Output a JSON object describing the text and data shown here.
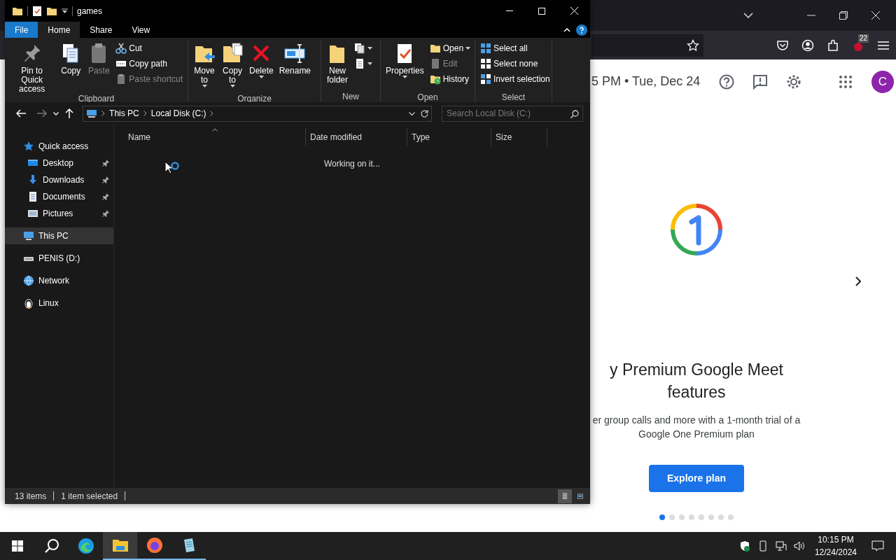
{
  "explorer": {
    "title": "games",
    "tabs": [
      {
        "label": "File",
        "kind": "file",
        "selected": false
      },
      {
        "label": "Home",
        "kind": "tab",
        "selected": true
      },
      {
        "label": "Share",
        "kind": "tab",
        "selected": false
      },
      {
        "label": "View",
        "kind": "tab",
        "selected": false
      }
    ],
    "ribbon": [
      {
        "label": "Clipboard",
        "items": [
          {
            "label": "Pin to Quick\naccess",
            "kind": "large",
            "disabled": false,
            "dropdown": false
          },
          {
            "label": "Copy",
            "kind": "large",
            "disabled": false,
            "dropdown": false
          },
          {
            "label": "Paste",
            "kind": "large",
            "disabled": true,
            "dropdown": false
          },
          {
            "label": "Cut",
            "kind": "small",
            "disabled": false,
            "dropdown": false
          },
          {
            "label": "Copy path",
            "kind": "small",
            "disabled": false,
            "dropdown": false
          },
          {
            "label": "Paste shortcut",
            "kind": "small",
            "disabled": true,
            "dropdown": false
          }
        ]
      },
      {
        "label": "Organize",
        "items": [
          {
            "label": "Move\nto",
            "kind": "large",
            "disabled": false,
            "dropdown": true
          },
          {
            "label": "Copy\nto",
            "kind": "large",
            "disabled": false,
            "dropdown": true
          },
          {
            "label": "Delete",
            "kind": "large",
            "disabled": false,
            "dropdown": true
          },
          {
            "label": "Rename",
            "kind": "large",
            "disabled": false,
            "dropdown": false
          }
        ]
      },
      {
        "label": "New",
        "items": [
          {
            "label": "New\nfolder",
            "kind": "large",
            "disabled": false,
            "dropdown": false
          },
          {
            "kind": "icon",
            "disabled": false,
            "dropdown": true
          },
          {
            "kind": "icon",
            "disabled": false,
            "dropdown": true
          }
        ]
      },
      {
        "label": "Open",
        "items": [
          {
            "label": "Properties",
            "kind": "large",
            "disabled": false,
            "dropdown": true
          },
          {
            "label": "Open",
            "kind": "small",
            "disabled": false,
            "dropdown": true
          },
          {
            "label": "Edit",
            "kind": "small",
            "disabled": true,
            "dropdown": false
          },
          {
            "label": "History",
            "kind": "small",
            "disabled": false,
            "dropdown": false
          }
        ]
      },
      {
        "label": "Select",
        "items": [
          {
            "label": "Select all",
            "kind": "small",
            "disabled": false,
            "dropdown": false
          },
          {
            "label": "Select none",
            "kind": "small",
            "disabled": false,
            "dropdown": false
          },
          {
            "label": "Invert selection",
            "kind": "small",
            "disabled": false,
            "dropdown": false
          }
        ]
      }
    ],
    "address": {
      "crumbs": [
        "This PC",
        "Local Disk (C:)"
      ]
    },
    "search": {
      "placeholder": "Search Local Disk (C:)"
    },
    "nav": [
      {
        "label": "Quick access",
        "selected": false,
        "children": [
          {
            "label": "Desktop",
            "pinned": true,
            "selected": false
          },
          {
            "label": "Downloads",
            "pinned": true,
            "selected": false
          },
          {
            "label": "Documents",
            "pinned": true,
            "selected": false
          },
          {
            "label": "Pictures",
            "pinned": true,
            "selected": false
          }
        ]
      },
      {
        "label": "This PC",
        "selected": true
      },
      {
        "label": "PENIS (D:)",
        "selected": false
      },
      {
        "label": "Network",
        "selected": false
      },
      {
        "label": "Linux",
        "selected": false
      }
    ],
    "columns": [
      {
        "label": "Name",
        "sorted": true
      },
      {
        "label": "Date modified",
        "sorted": false
      },
      {
        "label": "Type",
        "sorted": false
      },
      {
        "label": "Size",
        "sorted": false
      }
    ],
    "message": "Working on it...",
    "status": [
      "13 items",
      "1 item selected"
    ],
    "views": [
      {
        "kind": "details",
        "selected": true
      },
      {
        "kind": "large-icons",
        "selected": false
      }
    ]
  },
  "browser": {
    "badge": "22",
    "header_text": "5 PM • Tue, Dec 24",
    "avatar": "C",
    "headline": "y Premium Google Meet features",
    "body": "er group calls and more with a 1-month trial of a Google One Premium plan",
    "button": "Explore plan",
    "dots": [
      {
        "selected": true
      },
      {
        "selected": false
      },
      {
        "selected": false
      },
      {
        "selected": false
      },
      {
        "selected": false
      },
      {
        "selected": false
      },
      {
        "selected": false
      },
      {
        "selected": false
      }
    ]
  },
  "taskbar": {
    "apps": [
      {
        "kind": "edge",
        "selected": false,
        "running": false
      },
      {
        "kind": "explorer",
        "selected": true,
        "running": true
      },
      {
        "kind": "firefox",
        "selected": false,
        "running": true
      },
      {
        "kind": "notepad",
        "selected": false,
        "running": true
      }
    ],
    "time": "10:15 PM",
    "date": "12/24/2024"
  }
}
